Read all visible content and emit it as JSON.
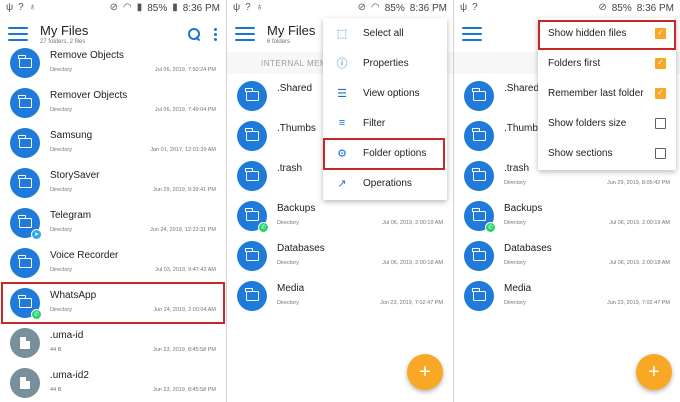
{
  "status_bar": {
    "battery": "85%",
    "time": "8:36 PM"
  },
  "screen1": {
    "title": "My Files",
    "subtitle": "27 folders, 2 files",
    "rows": [
      {
        "name": "Remove Objects",
        "type": "Directory",
        "date": "Jul 06, 2019, 7:50:24 PM",
        "kind": "folder"
      },
      {
        "name": "Remover Objects",
        "type": "Directory",
        "date": "Jul 06, 2019, 7:49:04 PM",
        "kind": "folder"
      },
      {
        "name": "Samsung",
        "type": "Directory",
        "date": "Jan 01, 2017, 12:01:39 AM",
        "kind": "folder"
      },
      {
        "name": "StorySaver",
        "type": "Directory",
        "date": "Jun 29, 2019, 9:39:41 PM",
        "kind": "folder"
      },
      {
        "name": "Telegram",
        "type": "Directory",
        "date": "Jun 24, 2019, 12:23:31 PM",
        "kind": "folder",
        "badge": "tg"
      },
      {
        "name": "Voice Recorder",
        "type": "Directory",
        "date": "Jul 03, 2019, 9:47:42 AM",
        "kind": "folder"
      },
      {
        "name": "WhatsApp",
        "type": "Directory",
        "date": "Jun 24, 2019, 2:00:04 AM",
        "kind": "folder",
        "badge": "wa"
      },
      {
        "name": ".uma-id",
        "type": "44 B",
        "date": "Jun 23, 2019, 8:45:58 PM",
        "kind": "file"
      },
      {
        "name": ".uma-id2",
        "type": "44 B",
        "date": "Jun 23, 2019, 8:45:58 PM",
        "kind": "file"
      }
    ]
  },
  "screen2": {
    "title": "My Files",
    "subtitle": "6 folders",
    "tab_label": "INTERNAL MEM",
    "rows": [
      {
        "name": ".Shared",
        "type": "",
        "date": "",
        "kind": "folder"
      },
      {
        "name": ".Thumbs",
        "type": "",
        "date": "",
        "kind": "folder"
      },
      {
        "name": ".trash",
        "type": "",
        "date": "",
        "kind": "folder"
      },
      {
        "name": "Backups",
        "type": "Directory",
        "date": "Jul 06, 2019, 2:00:19 AM",
        "kind": "folder",
        "badge": "wa"
      },
      {
        "name": "Databases",
        "type": "Directory",
        "date": "Jul 06, 2019, 2:00:18 AM",
        "kind": "folder"
      },
      {
        "name": "Media",
        "type": "Directory",
        "date": "Jun 23, 2019, 7:02:47 PM",
        "kind": "folder"
      }
    ],
    "menu": [
      {
        "label": "Select all",
        "icon": "select-all-icon",
        "glyph": "⬚"
      },
      {
        "label": "Properties",
        "icon": "info-icon",
        "glyph": "ⓘ"
      },
      {
        "label": "View options",
        "icon": "list-view-icon",
        "glyph": "☰"
      },
      {
        "label": "Filter",
        "icon": "filter-icon",
        "glyph": "≡"
      },
      {
        "label": "Folder options",
        "icon": "tune-icon",
        "glyph": "⚙"
      },
      {
        "label": "Operations",
        "icon": "trending-icon",
        "glyph": "↗"
      }
    ]
  },
  "screen3": {
    "rows": [
      {
        "name": ".Shared",
        "type": "",
        "date": "",
        "kind": "folder"
      },
      {
        "name": ".Thumbs",
        "type": "",
        "date": "",
        "kind": "folder"
      },
      {
        "name": ".trash",
        "type": "Directory",
        "date": "Jun 29, 2019, 8:05:42 PM",
        "kind": "folder"
      },
      {
        "name": "Backups",
        "type": "Directory",
        "date": "Jul 06, 2019, 2:00:19 AM",
        "kind": "folder",
        "badge": "wa"
      },
      {
        "name": "Databases",
        "type": "Directory",
        "date": "Jul 06, 2019, 2:00:18 AM",
        "kind": "folder"
      },
      {
        "name": "Media",
        "type": "Directory",
        "date": "Jun 23, 2019, 7:02:47 PM",
        "kind": "folder"
      }
    ],
    "options": [
      {
        "label": "Show hidden files",
        "checked": true
      },
      {
        "label": "Folders first",
        "checked": true
      },
      {
        "label": "Remember last folder",
        "checked": true
      },
      {
        "label": "Show folders size",
        "checked": false
      },
      {
        "label": "Show sections",
        "checked": false
      }
    ]
  },
  "colors": {
    "accent": "#1976d2",
    "folder": "#1f7ad9",
    "highlight": "#c62828",
    "fab": "#f9a825"
  }
}
